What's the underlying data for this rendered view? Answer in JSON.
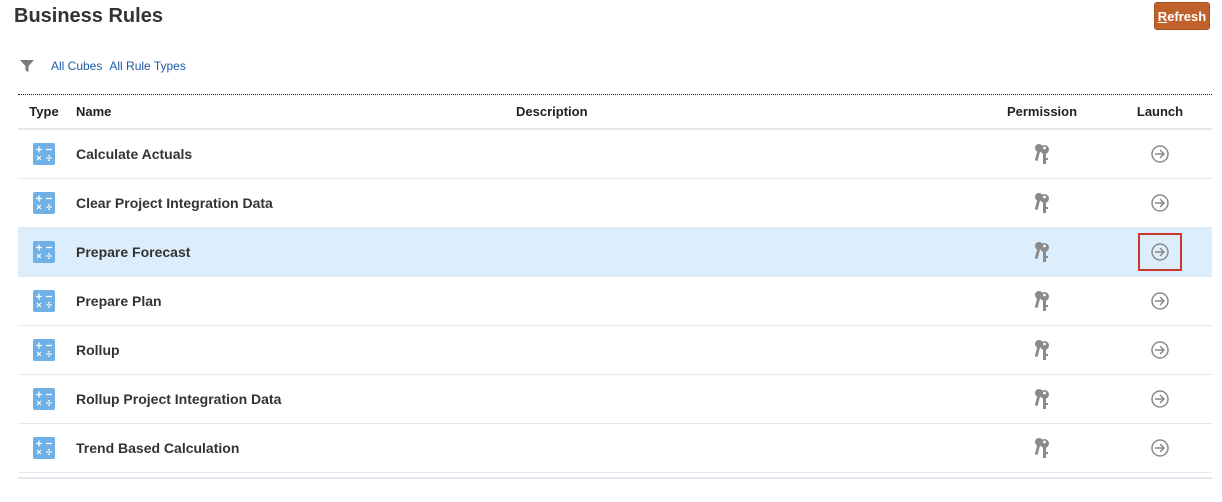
{
  "page": {
    "title": "Business Rules",
    "refresh_label_mnemonic": "R",
    "refresh_label_rest": "efresh"
  },
  "filters": {
    "icon": "filter-icon",
    "items": [
      "All Cubes",
      "All Rule Types"
    ]
  },
  "table": {
    "columns": {
      "type": "Type",
      "name": "Name",
      "description": "Description",
      "permission": "Permission",
      "launch": "Launch"
    },
    "rows": [
      {
        "type_icon": "calculation-icon",
        "name": "Calculate Actuals",
        "description": "",
        "permission_icon": "keys-icon",
        "launch_icon": "arrow-circle-right-icon"
      },
      {
        "type_icon": "calculation-icon",
        "name": "Clear Project Integration Data",
        "description": "",
        "permission_icon": "keys-icon",
        "launch_icon": "arrow-circle-right-icon"
      },
      {
        "type_icon": "calculation-icon",
        "name": "Prepare Forecast",
        "description": "",
        "permission_icon": "keys-icon",
        "launch_icon": "arrow-circle-right-icon",
        "selected": true,
        "launch_focused": true
      },
      {
        "type_icon": "calculation-icon",
        "name": "Prepare Plan",
        "description": "",
        "permission_icon": "keys-icon",
        "launch_icon": "arrow-circle-right-icon"
      },
      {
        "type_icon": "calculation-icon",
        "name": "Rollup",
        "description": "",
        "permission_icon": "keys-icon",
        "launch_icon": "arrow-circle-right-icon"
      },
      {
        "type_icon": "calculation-icon",
        "name": "Rollup Project Integration Data",
        "description": "",
        "permission_icon": "keys-icon",
        "launch_icon": "arrow-circle-right-icon"
      },
      {
        "type_icon": "calculation-icon",
        "name": "Trend Based Calculation",
        "description": "",
        "permission_icon": "keys-icon",
        "launch_icon": "arrow-circle-right-icon"
      }
    ]
  },
  "colors": {
    "accent_button": "#c0612b",
    "link": "#1f5ba8",
    "selected_row": "#dcedfc",
    "focus_outline": "#c9372c",
    "calc_icon": "#6fb1e6"
  }
}
